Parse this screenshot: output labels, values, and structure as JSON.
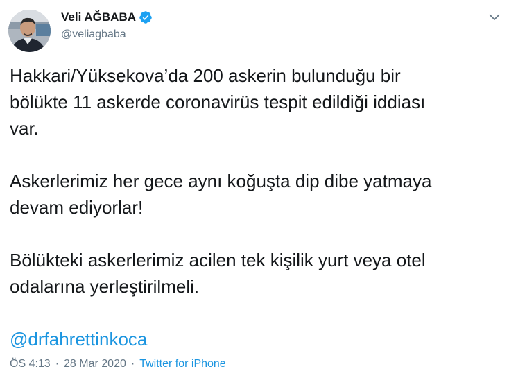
{
  "user": {
    "display_name": "Veli AĞBABA",
    "handle": "@veliagbaba",
    "verified": true,
    "avatar_icon": "profile-photo",
    "verified_icon": "verified-badge-icon"
  },
  "menu": {
    "icon": "chevron-down-icon"
  },
  "tweet": {
    "paragraphs": [
      "Hakkari/Yüksekova’da 200 askerin bulunduğu bir\nbölükte 11 askerde coronavirüs tespit edildiği iddiası\nvar.",
      "Askerlerimiz her gece aynı koğuşta dip dibe yatmaya\ndevam ediyorlar!",
      "Bölükteki askerlerimiz acilen tek kişilik yurt veya otel\nodalarına yerleştirilmeli."
    ],
    "mention": "@drfahrettinkoca"
  },
  "meta": {
    "time": "ÖS 4:13",
    "separator": "·",
    "date": "28 Mar 2020",
    "source": "Twitter for iPhone"
  },
  "colors": {
    "text": "#14171a",
    "secondary": "#657786",
    "link": "#1b95e0",
    "verified": "#1da1f2"
  }
}
